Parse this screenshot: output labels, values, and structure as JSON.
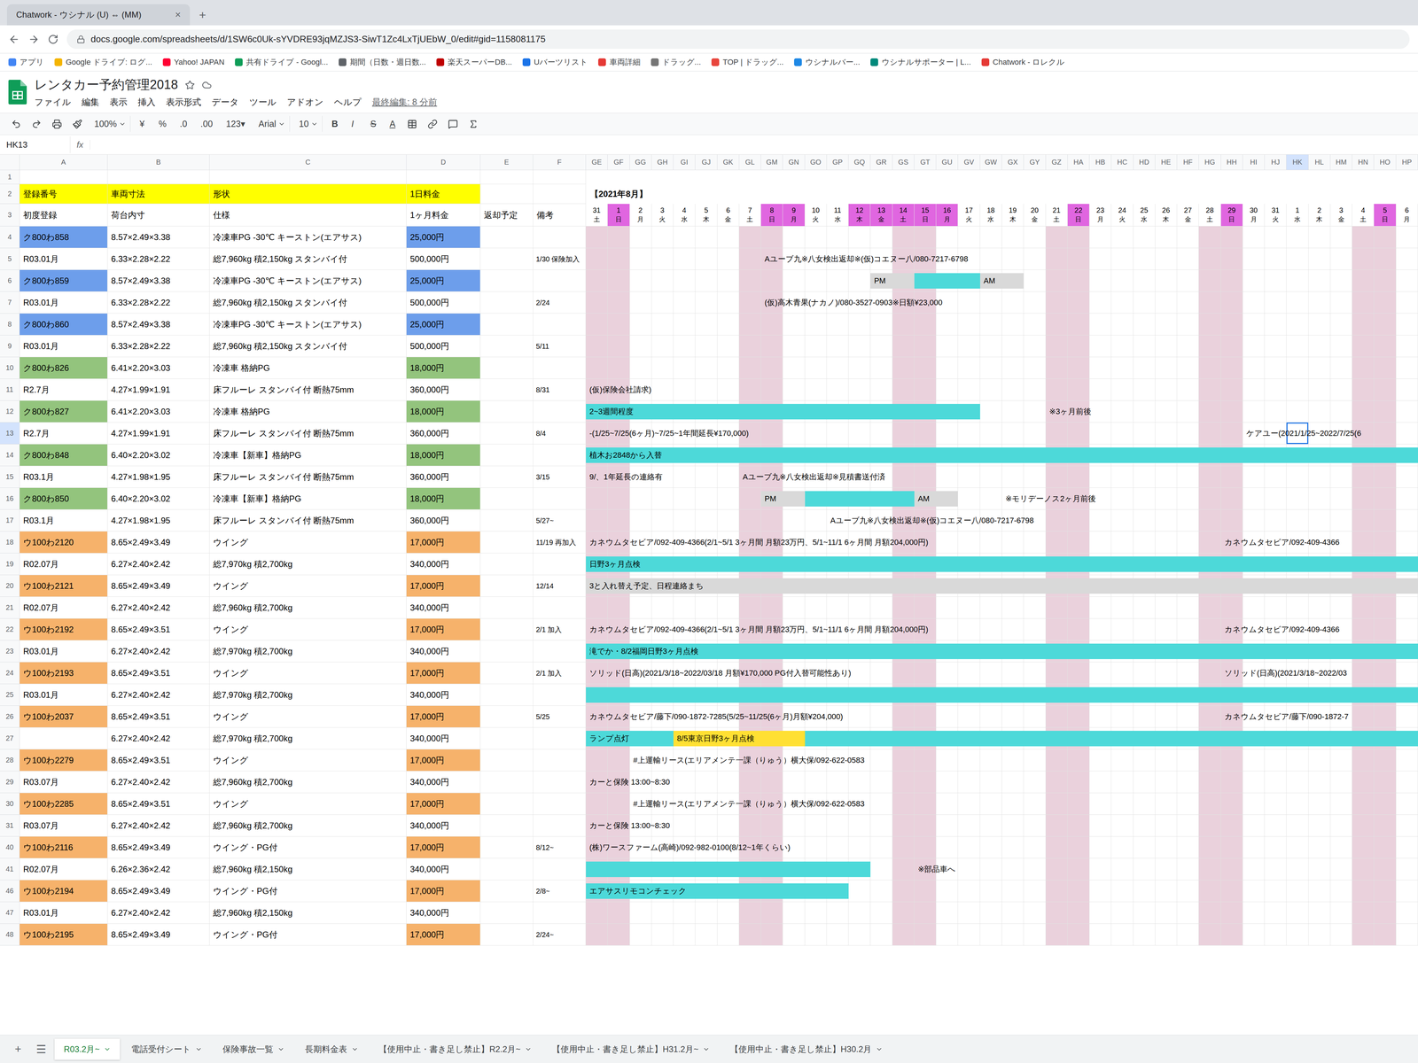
{
  "browser": {
    "tabs": [
      {
        "title": "Chatwork - ウシナル (U) ⇔ (MM)",
        "selected": false
      }
    ],
    "close": "×",
    "new_tab": "+",
    "url": "docs.google.com/spreadsheets/d/1SW6c0Uk-sYVDRE93jqMZJS3-SiwT1Zc4LxTjUEbW_0/edit#gid=1158081175",
    "bookmarks": [
      {
        "label": "アプリ",
        "color": "#4285f4"
      },
      {
        "label": "Google ドライブ: ログ...",
        "color": "#f4b400"
      },
      {
        "label": "Yahoo! JAPAN",
        "color": "#ff0033"
      },
      {
        "label": "共有ドライブ - Googl...",
        "color": "#0f9d58"
      },
      {
        "label": "期間（日数・週日数...",
        "color": "#5f6368"
      },
      {
        "label": "楽天スーパーDB...",
        "color": "#bf0000"
      },
      {
        "label": "Uバーツリスト",
        "color": "#1a73e8"
      },
      {
        "label": "車両詳細",
        "color": "#e53935"
      },
      {
        "label": "ドラッグ...",
        "color": "#757575"
      },
      {
        "label": "TOP | ドラッグ...",
        "color": "#e8453c"
      },
      {
        "label": "ウシナルバー...",
        "color": "#1e88e5"
      },
      {
        "label": "ウシナルサポーター | L...",
        "color": "#00897b"
      },
      {
        "label": "Chatwork - ロレクル",
        "color": "#e53935"
      }
    ]
  },
  "doc": {
    "title": "レンタカー予約管理2018",
    "menus": [
      "ファイル",
      "編集",
      "表示",
      "挿入",
      "表示形式",
      "データ",
      "ツール",
      "アドオン",
      "ヘルプ"
    ],
    "last_edit": "最終編集: 8 分前"
  },
  "toolbar": [
    {
      "label": "100%",
      "kind": "dropdown"
    },
    {
      "label": "¥",
      "kind": "text"
    },
    {
      "label": "%",
      "kind": "text"
    },
    {
      "label": ".0",
      "kind": "text"
    },
    {
      "label": ".00",
      "kind": "text"
    },
    {
      "label": "123▾",
      "kind": "text"
    },
    {
      "label": "Arial",
      "kind": "dropdown"
    },
    {
      "label": "10",
      "kind": "dropdown"
    },
    {
      "label": "B",
      "kind": "bold"
    },
    {
      "label": "I",
      "kind": "italic"
    },
    {
      "label": "S",
      "kind": "strike"
    },
    {
      "label": "A",
      "kind": "underline"
    }
  ],
  "formula_bar": {
    "name_box": "HK13",
    "fx": "fx",
    "value": ""
  },
  "selection": {
    "row": "13",
    "column": "HK"
  },
  "columns": [
    "A",
    "B",
    "C",
    "D",
    "E",
    "F"
  ],
  "day_columns": [
    "GE",
    "GF",
    "GG",
    "GH",
    "GI",
    "GJ",
    "GK",
    "GL",
    "GM",
    "GN",
    "GO",
    "GP",
    "GQ",
    "GR",
    "GS",
    "GT",
    "GU",
    "GV",
    "GW",
    "GX",
    "GY",
    "GZ",
    "HA",
    "HB",
    "HC",
    "HD",
    "HE",
    "HF",
    "HG",
    "HH",
    "HI",
    "HJ",
    "HK",
    "HL",
    "HM",
    "HN",
    "HO",
    "HP"
  ],
  "header_rows": [
    {
      "num": "1",
      "cells": [
        "",
        "",
        "",
        "",
        "",
        ""
      ]
    },
    {
      "num": "2",
      "cells": [
        "登録番号",
        "車両寸法",
        "形状",
        "1日料金",
        "",
        ""
      ]
    },
    {
      "num": "3",
      "cells": [
        "初度登録",
        "荷台内寸",
        "仕様",
        "1ヶ月料金",
        "返却予定",
        "備考"
      ]
    }
  ],
  "month_label": "【2021年8月】",
  "days": [
    {
      "d": "31",
      "w": "土",
      "color": "#ffffff",
      "shaded": true
    },
    {
      "d": "1",
      "w": "日",
      "color": "#e066e0",
      "shaded": true
    },
    {
      "d": "2",
      "w": "月",
      "color": "#ffffff",
      "shaded": false
    },
    {
      "d": "3",
      "w": "火",
      "color": "#ffffff",
      "shaded": false
    },
    {
      "d": "4",
      "w": "水",
      "color": "#ffffff",
      "shaded": false
    },
    {
      "d": "5",
      "w": "木",
      "color": "#ffffff",
      "shaded": false
    },
    {
      "d": "6",
      "w": "金",
      "color": "#ffffff",
      "shaded": false
    },
    {
      "d": "7",
      "w": "土",
      "color": "#ffffff",
      "shaded": true
    },
    {
      "d": "8",
      "w": "日",
      "color": "#e066e0",
      "shaded": true
    },
    {
      "d": "9",
      "w": "月",
      "color": "#e066e0",
      "shaded": false
    },
    {
      "d": "10",
      "w": "火",
      "color": "#ffffff",
      "shaded": false
    },
    {
      "d": "11",
      "w": "水",
      "color": "#ffffff",
      "shaded": false
    },
    {
      "d": "12",
      "w": "木",
      "color": "#e066e0",
      "shaded": false
    },
    {
      "d": "13",
      "w": "金",
      "color": "#e066e0",
      "shaded": false
    },
    {
      "d": "14",
      "w": "土",
      "color": "#e066e0",
      "shaded": true
    },
    {
      "d": "15",
      "w": "日",
      "color": "#e066e0",
      "shaded": true
    },
    {
      "d": "16",
      "w": "月",
      "color": "#e066e0",
      "shaded": false
    },
    {
      "d": "17",
      "w": "火",
      "color": "#ffffff",
      "shaded": false
    },
    {
      "d": "18",
      "w": "水",
      "color": "#ffffff",
      "shaded": false
    },
    {
      "d": "19",
      "w": "木",
      "color": "#ffffff",
      "shaded": false
    },
    {
      "d": "20",
      "w": "金",
      "color": "#ffffff",
      "shaded": false
    },
    {
      "d": "21",
      "w": "土",
      "color": "#ffffff",
      "shaded": true
    },
    {
      "d": "22",
      "w": "日",
      "color": "#e066e0",
      "shaded": true
    },
    {
      "d": "23",
      "w": "月",
      "color": "#ffffff",
      "shaded": false
    },
    {
      "d": "24",
      "w": "火",
      "color": "#ffffff",
      "shaded": false
    },
    {
      "d": "25",
      "w": "水",
      "color": "#ffffff",
      "shaded": false
    },
    {
      "d": "26",
      "w": "木",
      "color": "#ffffff",
      "shaded": false
    },
    {
      "d": "27",
      "w": "金",
      "color": "#ffffff",
      "shaded": false
    },
    {
      "d": "28",
      "w": "土",
      "color": "#ffffff",
      "shaded": true
    },
    {
      "d": "29",
      "w": "日",
      "color": "#e066e0",
      "shaded": true
    },
    {
      "d": "30",
      "w": "月",
      "color": "#ffffff",
      "shaded": false
    },
    {
      "d": "31",
      "w": "火",
      "color": "#ffffff",
      "shaded": false
    },
    {
      "d": "1",
      "w": "水",
      "color": "#ffffff",
      "shaded": false
    },
    {
      "d": "2",
      "w": "木",
      "color": "#ffffff",
      "shaded": false
    },
    {
      "d": "3",
      "w": "金",
      "color": "#ffffff",
      "shaded": false
    },
    {
      "d": "4",
      "w": "土",
      "color": "#ffffff",
      "shaded": true
    },
    {
      "d": "5",
      "w": "日",
      "color": "#e066e0",
      "shaded": true
    },
    {
      "d": "6",
      "w": "月",
      "color": "#ffffff",
      "shaded": false
    }
  ],
  "rows": [
    {
      "num": "4",
      "a": "ク800わ858",
      "b": "8.57×2.49×3.38",
      "c": "冷凍車PG -30℃ キーストン(エアサス)",
      "d": "25,000円",
      "f": "",
      "color": "#6d9eeb",
      "bars": []
    },
    {
      "num": "5",
      "a": "R03.01月",
      "b": "6.33×2.28×2.22",
      "c": "総7,960kg 積2,150kg スタンバイ付",
      "d": "500,000円",
      "f": "1/30 保険加入",
      "color": "#ffffff",
      "bars": [
        {
          "text": "Aユーブ九※八女検出返却※(仮)コエヌー八/080-7217-6798",
          "start": 8,
          "span": 16,
          "color": "#ffffff"
        }
      ]
    },
    {
      "num": "6",
      "a": "ク800わ859",
      "b": "8.57×2.49×3.38",
      "c": "冷凍車PG -30℃ キーストン(エアサス)",
      "d": "25,000円",
      "f": "",
      "color": "#6d9eeb",
      "bars": [
        {
          "text": "PM",
          "start": 13,
          "span": 2,
          "color": "#d9d9d9"
        },
        {
          "text": "",
          "start": 15,
          "span": 3,
          "color": "#4dd9d9"
        },
        {
          "text": "AM",
          "start": 18,
          "span": 2,
          "color": "#d9d9d9"
        }
      ]
    },
    {
      "num": "7",
      "a": "R03.01月",
      "b": "6.33×2.28×2.22",
      "c": "総7,960kg 積2,150kg スタンバイ付",
      "d": "500,000円",
      "f": "2/24",
      "color": "#ffffff",
      "bars": [
        {
          "text": "(仮)高木青果(ナカノ)/080-3527-0903※日額¥23,000",
          "start": 8,
          "span": 14,
          "color": "#ffffff"
        }
      ]
    },
    {
      "num": "8",
      "a": "ク800わ860",
      "b": "8.57×2.49×3.38",
      "c": "冷凍車PG -30℃ キーストン(エアサス)",
      "d": "25,000円",
      "f": "",
      "color": "#6d9eeb",
      "bars": []
    },
    {
      "num": "9",
      "a": "R03.01月",
      "b": "6.33×2.28×2.22",
      "c": "総7,960kg 積2,150kg スタンバイ付",
      "d": "500,000円",
      "f": "5/11",
      "color": "#ffffff",
      "bars": []
    },
    {
      "num": "10",
      "a": "ク800わ826",
      "b": "6.41×2.20×3.03",
      "c": "冷凍車 格納PG",
      "d": "18,000円",
      "f": "",
      "color": "#93c47d",
      "bars": []
    },
    {
      "num": "11",
      "a": "R2.7月",
      "b": "4.27×1.99×1.91",
      "c": "床フルーレ スタンバイ付 断熱75mm",
      "d": "360,000円",
      "f": "8/31",
      "color": "#ffffff",
      "bars": [
        {
          "text": "(仮)保険会社請求)",
          "start": 0,
          "span": 5,
          "color": "#ffffff"
        }
      ]
    },
    {
      "num": "12",
      "a": "ク800わ827",
      "b": "6.41×2.20×3.03",
      "c": "冷凍車 格納PG",
      "d": "18,000円",
      "f": "",
      "color": "#93c47d",
      "bars": [
        {
          "text": "2~3週間程度",
          "start": 0,
          "span": 18,
          "color": "#4dd9d9"
        },
        {
          "text": "※3ヶ月前後",
          "start": 21,
          "span": 6,
          "color": "#ffffff"
        }
      ]
    },
    {
      "num": "13",
      "a": "R2.7月",
      "b": "4.27×1.99×1.91",
      "c": "床フルーレ スタンバイ付 断熱75mm",
      "d": "360,000円",
      "f": "8/4",
      "color": "#ffffff",
      "bars": [
        {
          "text": "-(1/25~7/25(6ヶ月)~7/25~1年間延長¥170,000)",
          "start": 0,
          "span": 15,
          "color": "#ffffff"
        },
        {
          "text": "ケアユー(2021/1/25~2022/7/25(6",
          "start": 30,
          "span": 8,
          "color": "#ffffff"
        }
      ]
    },
    {
      "num": "14",
      "a": "ク800わ848",
      "b": "6.40×2.20×3.02",
      "c": "冷凍車【新車】格納PG",
      "d": "18,000円",
      "f": "",
      "color": "#93c47d",
      "bars": [
        {
          "text": "植木お2848から入替",
          "start": 0,
          "span": 38,
          "color": "#4dd9d9"
        }
      ]
    },
    {
      "num": "15",
      "a": "R03.1月",
      "b": "4.27×1.98×1.95",
      "c": "床フルーレ スタンバイ付 断熱75mm",
      "d": "360,000円",
      "f": "3/15",
      "color": "#ffffff",
      "bars": [
        {
          "text": "9/、1年延長の連絡有",
          "start": 0,
          "span": 6,
          "color": "#ffffff"
        },
        {
          "text": "Aユーブ九※八女検出返却※見積書送付済",
          "start": 7,
          "span": 15,
          "color": "#ffffff"
        }
      ]
    },
    {
      "num": "16",
      "a": "ク800わ850",
      "b": "6.40×2.20×3.02",
      "c": "冷凍車【新車】格納PG",
      "d": "18,000円",
      "f": "",
      "color": "#93c47d",
      "bars": [
        {
          "text": "PM",
          "start": 8,
          "span": 2,
          "color": "#d9d9d9"
        },
        {
          "text": "",
          "start": 10,
          "span": 5,
          "color": "#4dd9d9"
        },
        {
          "text": "AM",
          "start": 15,
          "span": 2,
          "color": "#d9d9d9"
        },
        {
          "text": "※モリデーノス2ヶ月前後",
          "start": 19,
          "span": 8,
          "color": "#ffffff"
        }
      ]
    },
    {
      "num": "17",
      "a": "R03.1月",
      "b": "4.27×1.98×1.95",
      "c": "床フルーレ スタンバイ付 断熱75mm",
      "d": "360,000円",
      "f": "5/27~",
      "color": "#ffffff",
      "bars": [
        {
          "text": "Aユーブ九※八女検出返却※(仮)コエヌー八/080-7217-6798",
          "start": 11,
          "span": 18,
          "color": "#ffffff"
        }
      ]
    },
    {
      "num": "18",
      "a": "ウ100わ2120",
      "b": "8.65×2.49×3.49",
      "c": "ウイング",
      "d": "17,000円",
      "f": "11/19 再加入",
      "color": "#f6b26b",
      "bars": [
        {
          "text": "カネウムタセビア/092-409-4366(2/1~5/1 3ヶ月間 月額23万円、5/1~11/1 6ヶ月間 月額204,000円)",
          "start": 0,
          "span": 28,
          "color": "#ffffff"
        },
        {
          "text": "カネウムタセビア/092-409-4366",
          "start": 29,
          "span": 9,
          "color": "#ffffff"
        }
      ]
    },
    {
      "num": "19",
      "a": "R02.07月",
      "b": "6.27×2.40×2.42",
      "c": "総7,970kg 積2,700kg",
      "d": "340,000円",
      "f": "",
      "color": "#ffffff",
      "bars": [
        {
          "text": "日野3ヶ月点検",
          "start": 0,
          "span": 38,
          "color": "#4dd9d9"
        }
      ]
    },
    {
      "num": "20",
      "a": "ウ100わ2121",
      "b": "8.65×2.49×3.49",
      "c": "ウイング",
      "d": "17,000円",
      "f": "12/14",
      "color": "#f6b26b",
      "bars": [
        {
          "text": "3と入れ替え予定、日程連絡まち",
          "start": 0,
          "span": 38,
          "color": "#d9d9d9"
        }
      ]
    },
    {
      "num": "21",
      "a": "R02.07月",
      "b": "6.27×2.40×2.42",
      "c": "総7,960kg 積2,700kg",
      "d": "340,000円",
      "f": "",
      "color": "#ffffff",
      "bars": []
    },
    {
      "num": "22",
      "a": "ウ100わ2192",
      "b": "8.65×2.49×3.51",
      "c": "ウイング",
      "d": "17,000円",
      "f": "2/1 加入",
      "color": "#f6b26b",
      "bars": [
        {
          "text": "カネウムタセビア/092-409-4366(2/1~5/1 3ヶ月間 月額23万円、5/1~11/1 6ヶ月間 月額204,000円)",
          "start": 0,
          "span": 28,
          "color": "#ffffff"
        },
        {
          "text": "カネウムタセビア/092-409-4366",
          "start": 29,
          "span": 9,
          "color": "#ffffff"
        }
      ]
    },
    {
      "num": "23",
      "a": "R03.01月",
      "b": "6.27×2.40×2.42",
      "c": "総7,970kg 積2,700kg",
      "d": "340,000円",
      "f": "",
      "color": "#ffffff",
      "bars": [
        {
          "text": "滝でか・8/2福岡日野3ヶ月点検",
          "start": 0,
          "span": 38,
          "color": "#4dd9d9"
        }
      ]
    },
    {
      "num": "24",
      "a": "ウ100わ2193",
      "b": "8.65×2.49×3.51",
      "c": "ウイング",
      "d": "17,000円",
      "f": "2/1 加入",
      "color": "#f6b26b",
      "bars": [
        {
          "text": "ソリッド(日高)(2021/3/18~2022/03/18 月額¥170,000 PG付入替可能性あり)",
          "start": 0,
          "span": 28,
          "color": "#ffffff"
        },
        {
          "text": "ソリッド(日高)(2021/3/18~2022/03",
          "start": 29,
          "span": 9,
          "color": "#ffffff"
        }
      ]
    },
    {
      "num": "25",
      "a": "R03.01月",
      "b": "6.27×2.40×2.42",
      "c": "総7,970kg 積2,700kg",
      "d": "340,000円",
      "f": "",
      "color": "#ffffff",
      "bars": [
        {
          "text": "",
          "start": 0,
          "span": 38,
          "color": "#4dd9d9"
        }
      ]
    },
    {
      "num": "26",
      "a": "ウ100わ2037",
      "b": "8.65×2.49×3.51",
      "c": "ウイング",
      "d": "17,000円",
      "f": "5/25",
      "color": "#f6b26b",
      "bars": [
        {
          "text": "カネウムタセビア/藤下/090-1872-7285(5/25~11/25(6ヶ月)月額¥204,000)",
          "start": 0,
          "span": 28,
          "color": "#ffffff"
        },
        {
          "text": "カネウムタセビア/藤下/090-1872-7",
          "start": 29,
          "span": 9,
          "color": "#ffffff"
        }
      ]
    },
    {
      "num": "27",
      "a": "",
      "b": "6.27×2.40×2.42",
      "c": "総7,970kg 積2,700kg",
      "d": "340,000円",
      "f": "",
      "color": "#ffffff",
      "bars": [
        {
          "text": "ランプ点灯",
          "start": 0,
          "span": 4,
          "color": "#4dd9d9"
        },
        {
          "text": "8/5東京日野3ヶ月点検",
          "start": 4,
          "span": 6,
          "color": "#ffe033"
        },
        {
          "text": "",
          "start": 10,
          "span": 28,
          "color": "#4dd9d9"
        }
      ]
    },
    {
      "num": "28",
      "a": "ウ100わ2279",
      "b": "8.65×2.49×3.51",
      "c": "ウイング",
      "d": "17,000円",
      "f": "",
      "color": "#f6b26b",
      "bars": [
        {
          "text": "#上運輸リース(エリアメンテ一課（りゅう）横大保/092-622-0583",
          "start": 2,
          "span": 22,
          "color": "#ffffff"
        }
      ]
    },
    {
      "num": "29",
      "a": "R03.07月",
      "b": "6.27×2.40×2.42",
      "c": "総7,960kg 積2,700kg",
      "d": "340,000円",
      "f": "",
      "color": "#ffffff",
      "bars": [
        {
          "text": "カーと保険 13:00~8:30",
          "start": 0,
          "span": 7,
          "color": "#ffffff"
        }
      ]
    },
    {
      "num": "30",
      "a": "ウ100わ2285",
      "b": "8.65×2.49×3.51",
      "c": "ウイング",
      "d": "17,000円",
      "f": "",
      "color": "#f6b26b",
      "bars": [
        {
          "text": "#上運輸リース(エリアメンテ一課（りゅう）横大保/092-622-0583",
          "start": 2,
          "span": 22,
          "color": "#ffffff"
        }
      ]
    },
    {
      "num": "31",
      "a": "R03.07月",
      "b": "6.27×2.40×2.42",
      "c": "総7,960kg 積2,700kg",
      "d": "340,000円",
      "f": "",
      "color": "#ffffff",
      "bars": [
        {
          "text": "カーと保険 13:00~8:30",
          "start": 0,
          "span": 7,
          "color": "#ffffff"
        }
      ]
    },
    {
      "num": "40",
      "a": "ウ100わ2116",
      "b": "8.65×2.49×3.49",
      "c": "ウイング・PG付",
      "d": "17,000円",
      "f": "8/12~",
      "color": "#f6b26b",
      "bars": [
        {
          "text": "(株)ワースファーム(高崎)/092-982-0100(8/12~1年くらい)",
          "start": 0,
          "span": 18,
          "color": "#ffffff"
        }
      ]
    },
    {
      "num": "41",
      "a": "R02.07月",
      "b": "6.26×2.36×2.42",
      "c": "総7,960kg 積2,150kg",
      "d": "340,000円",
      "f": "",
      "color": "#ffffff",
      "bars": [
        {
          "text": "",
          "start": 0,
          "span": 13,
          "color": "#4dd9d9"
        },
        {
          "text": "※部品車へ",
          "start": 15,
          "span": 5,
          "color": "#ffffff"
        }
      ]
    },
    {
      "num": "46",
      "a": "ウ100わ2194",
      "b": "8.65×2.49×3.49",
      "c": "ウイング・PG付",
      "d": "17,000円",
      "f": "2/8~",
      "color": "#f6b26b",
      "bars": [
        {
          "text": "エアサスリモコンチェック",
          "start": 0,
          "span": 12,
          "color": "#4dd9d9"
        }
      ]
    },
    {
      "num": "47",
      "a": "R03.01月",
      "b": "6.27×2.40×2.42",
      "c": "総7,960kg 積2,150kg",
      "d": "340,000円",
      "f": "",
      "color": "#ffffff",
      "bars": []
    },
    {
      "num": "48",
      "a": "ウ100わ2195",
      "b": "8.65×2.49×3.49",
      "c": "ウイング・PG付",
      "d": "17,000円",
      "f": "2/24~",
      "color": "#f6b26b",
      "bars": []
    }
  ],
  "sheet_tabs": {
    "add": "+",
    "menu": "☰",
    "tabs": [
      {
        "label": "R03.2月~",
        "selected": true
      },
      {
        "label": "電話受付シート",
        "selected": false
      },
      {
        "label": "保険事故一覧",
        "selected": false
      },
      {
        "label": "長期料金表",
        "selected": false
      },
      {
        "label": "【使用中止・書き足し禁止】R2.2月~",
        "selected": false
      },
      {
        "label": "【使用中止・書き足し禁止】H31.2月~",
        "selected": false
      },
      {
        "label": "【使用中止・書き足し禁止】H30.2月",
        "selected": false
      }
    ]
  }
}
